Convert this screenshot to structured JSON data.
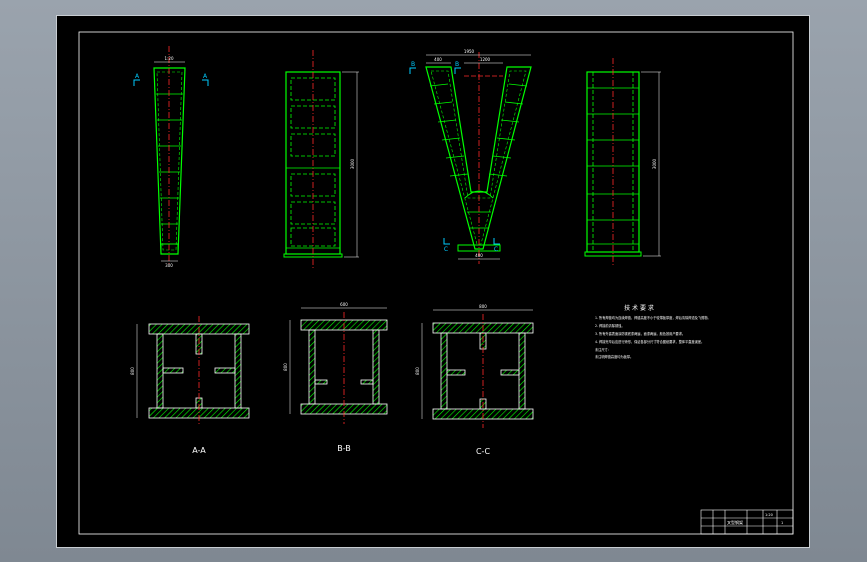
{
  "colors": {
    "background": "#000000",
    "frame": "#ffffff",
    "structure": "#00ff00",
    "centerline": "#ff2a2a",
    "dimension": "#ffffff",
    "hatch": "#00ff00",
    "cut_marker": "#00ccff"
  },
  "views": {
    "top_left": {
      "marker_left": "A",
      "marker_right": "A",
      "dim_top": "1:20",
      "dim_bottom": "300"
    },
    "front": {
      "dim_height": "3000"
    },
    "v_view": {
      "marker_b1": "B",
      "marker_b2": "B",
      "marker_c1": "C",
      "marker_c2": "C",
      "dim_top_overall": "1950",
      "dim_top_inner": "1200",
      "dim_top_left": "400",
      "dim_bottom": "400"
    },
    "right": {
      "dim_height": "3000"
    }
  },
  "sections": [
    {
      "label": "A-A",
      "dim_height": "800"
    },
    {
      "label": "B-B",
      "dim_width": "600",
      "dim_height": "800"
    },
    {
      "label": "C-C",
      "dim_width": "800",
      "dim_height": "800"
    }
  ],
  "notes": {
    "title": "技 术 要 求",
    "items": [
      "1. 所有焊缝均为连续焊缝，焊缝高度不小于较薄板厚度，焊后清除焊渣及飞溅物。",
      "2. 焊接前清除锈蚀。",
      "3. 所有外露表面涂防锈底漆两遍，面漆两遍，颜色按用户要求。",
      "4. 焊接完毕后应进行矫形，保证各部分尺寸符合图纸要求，整体平直度误差。",
      "未注尺寸：",
      "未注明焊缝高度均为板厚。"
    ]
  },
  "title_block": {
    "drawing_name": "叉型钢架",
    "scale": "1:20",
    "sheet": "1"
  }
}
